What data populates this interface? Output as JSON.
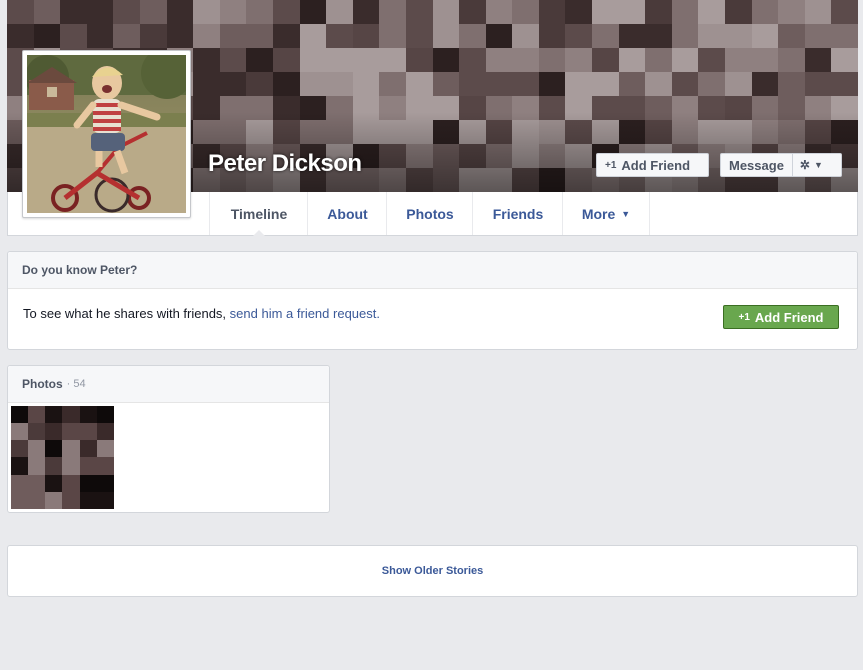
{
  "profile": {
    "name": "Peter Dickson",
    "add_friend_label": "Add Friend",
    "message_label": "Message"
  },
  "tabs": [
    {
      "label": "Timeline",
      "active": true
    },
    {
      "label": "About"
    },
    {
      "label": "Photos"
    },
    {
      "label": "Friends"
    },
    {
      "label": "More"
    }
  ],
  "know": {
    "title": "Do you know Peter?",
    "text_prefix": "To see what he shares with friends, ",
    "link": "send him a friend request.",
    "button_label": "Add Friend"
  },
  "photos": {
    "title": "Photos",
    "count": "· 54"
  },
  "older": {
    "label": "Show Older Stories"
  },
  "colors": {
    "link_blue": "#3b5998",
    "green_button": "#69a74e"
  }
}
